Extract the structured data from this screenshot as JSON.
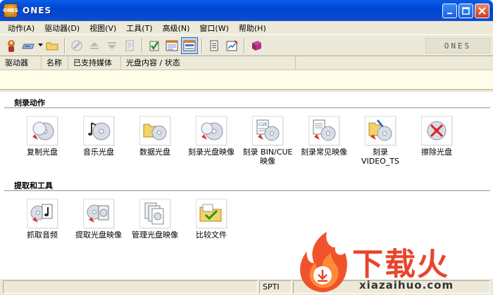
{
  "window": {
    "title": "ONES",
    "app_icon_text": "ONES"
  },
  "menu": [
    "动作(A)",
    "驱动器(D)",
    "视图(V)",
    "工具(T)",
    "高级(N)",
    "窗口(W)",
    "帮助(H)"
  ],
  "columns": [
    "驱动器",
    "名称",
    "已支持媒体",
    "光盘内容 / 状态"
  ],
  "sections": [
    {
      "title": "刻录动作",
      "items": [
        {
          "label": "复制光盘",
          "icon": "copy-disc-icon"
        },
        {
          "label": "音乐光盘",
          "icon": "music-disc-icon"
        },
        {
          "label": "数据光盘",
          "icon": "data-disc-icon"
        },
        {
          "label": "刻录光盘映像",
          "icon": "burn-image-icon"
        },
        {
          "label": "刻录 BIN/CUE\n映像",
          "icon": "bin-cue-icon"
        },
        {
          "label": "刻录常见映像",
          "icon": "burn-common-image-icon"
        },
        {
          "label": "刻录\nVIDEO_TS",
          "icon": "video-ts-icon"
        },
        {
          "label": "擦除光盘",
          "icon": "erase-disc-icon"
        }
      ]
    },
    {
      "title": "提取和工具",
      "items": [
        {
          "label": "抓取音频",
          "icon": "rip-audio-icon"
        },
        {
          "label": "提取光盘映像",
          "icon": "extract-image-icon"
        },
        {
          "label": "管理光盘映像",
          "icon": "manage-images-icon"
        },
        {
          "label": "比较文件",
          "icon": "compare-files-icon"
        }
      ]
    }
  ],
  "toolbar_brand": "ONES",
  "status": {
    "interface": "SPTI"
  },
  "watermark": {
    "brand": "下载火",
    "url": "xiazaihuo.com"
  },
  "colors": {
    "title_bar": "#0a5ee8",
    "accent": "#e8452b",
    "face": "#ece9d8"
  }
}
